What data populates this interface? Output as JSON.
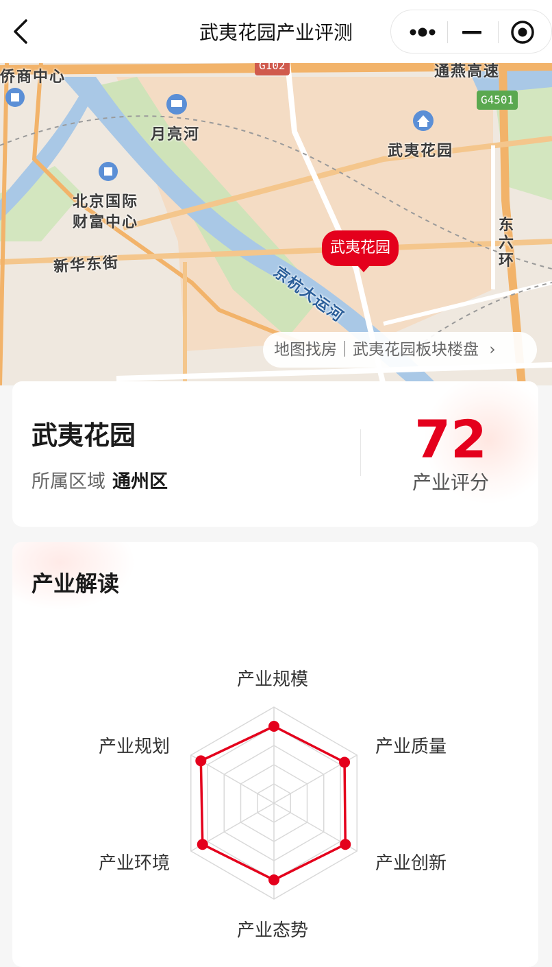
{
  "navbar": {
    "title": "武夷花园产业评测",
    "back_icon": "chevron-left-icon",
    "more_icon": "more-dots-icon",
    "minimize_icon": "minimize-icon",
    "close_icon": "target-close-icon"
  },
  "map": {
    "labels": {
      "qiao_shang": "侨商中心",
      "yueliang_he": "月亮河",
      "wuyi_poi": "武夷花园",
      "beijing_intl_1": "北京国际",
      "beijing_intl_2": "财富中心",
      "xinhua_street": "新华东街",
      "canal": "京杭大运河",
      "east_sixth_ring": "东六环",
      "tongyan_highway": "通燕高速"
    },
    "badges": {
      "g102": "G102",
      "g4501": "G4501"
    },
    "pin_label": "武夷花园",
    "link_text": "地图找房｜武夷花园板块楼盘",
    "link_arrow": "›"
  },
  "info": {
    "name": "武夷花园",
    "region_label": "所属区域",
    "region_value": "通州区",
    "score": "72",
    "score_label": "产业评分"
  },
  "analysis": {
    "title": "产业解读",
    "radar": {
      "axes": [
        "产业规模",
        "产业质量",
        "产业创新",
        "产业态势",
        "产业环境",
        "产业规划"
      ],
      "values": [
        0.8,
        0.85,
        0.86,
        0.8,
        0.86,
        0.88
      ],
      "line_color": "#e4001c",
      "grid_color": "#d9d9d9"
    }
  }
}
